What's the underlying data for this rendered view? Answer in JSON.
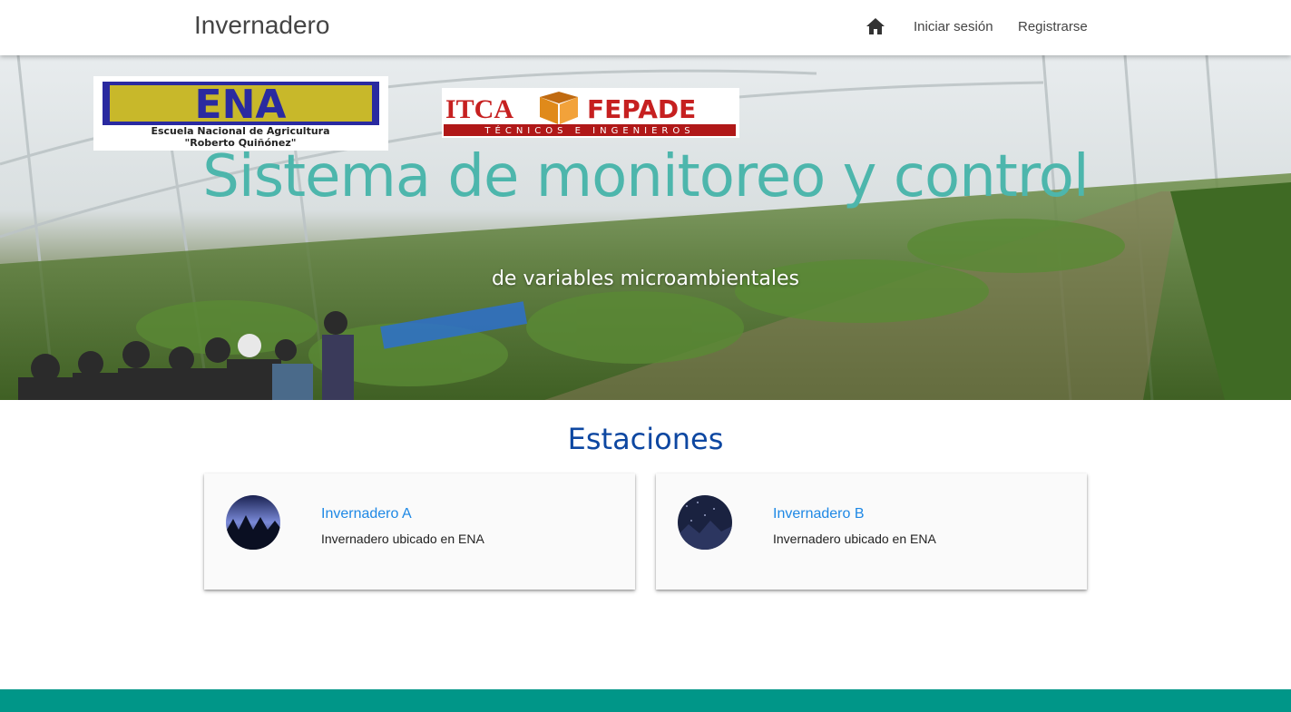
{
  "navbar": {
    "brand": "Invernadero",
    "home_icon": "home-icon",
    "login_label": "Iniciar sesión",
    "register_label": "Registrarse"
  },
  "hero": {
    "title": "Sistema de monitoreo y control",
    "subtitle": "de variables microambientales",
    "logos": {
      "ena": {
        "text": "ENA",
        "line1": "Escuela Nacional de Agricultura",
        "line2": "\"Roberto Quiñónez\""
      },
      "itca": {
        "text_left": "ITCA",
        "text_right": "FEPADE",
        "tagline": "TÉCNICOS E INGENIEROS"
      }
    }
  },
  "stations": {
    "heading": "Estaciones",
    "items": [
      {
        "title": "Invernadero A",
        "description": "Invernadero ubicado en ENA"
      },
      {
        "title": "Invernadero B",
        "description": "Invernadero ubicado en ENA"
      }
    ]
  },
  "colors": {
    "accent": "#4db6ac",
    "heading": "#0d47a1",
    "link": "#1e88e5",
    "footer": "#009688"
  }
}
